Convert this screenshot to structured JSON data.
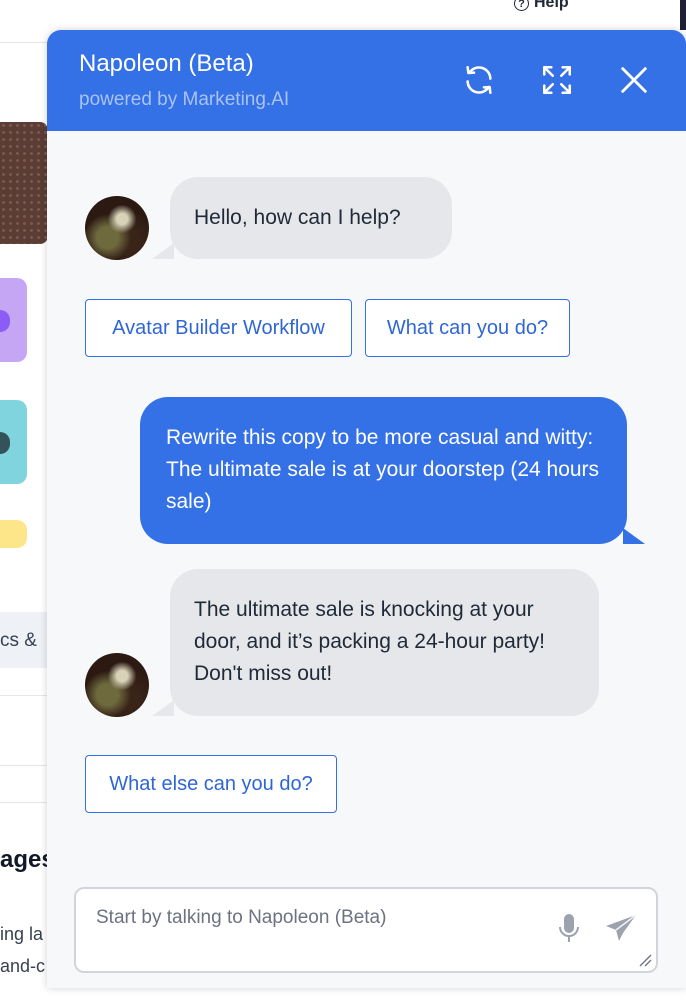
{
  "background": {
    "help_label": "Help",
    "menu_fragment": "cs &",
    "pages_fragment": "ages",
    "line1_fragment": "ing la",
    "line2_fragment": "and-c"
  },
  "chat": {
    "title": "Napoleon (Beta)",
    "subtitle": "powered by Marketing.AI",
    "header_icons": [
      "refresh-icon",
      "expand-icon",
      "close-icon"
    ],
    "messages": [
      {
        "role": "bot",
        "text": "Hello, how can I help?"
      },
      {
        "role": "user",
        "text": "Rewrite this copy to be more casual and witty: The ultimate sale is at your doorstep (24 hours sale)"
      },
      {
        "role": "bot",
        "text": "The ultimate sale is knocking at your door, and it’s packing a 24-hour party! Don't miss out!"
      }
    ],
    "suggestions_1": [
      "Avatar Builder Workflow",
      "What can you do?"
    ],
    "suggestions_2": [
      "What else can you do?"
    ],
    "input": {
      "placeholder": "Start by talking to Napoleon (Beta)",
      "value": ""
    },
    "colors": {
      "accent": "#3470e6",
      "bot_bubble": "#e5e7eb",
      "panel_bg": "#f7f8fa"
    }
  }
}
